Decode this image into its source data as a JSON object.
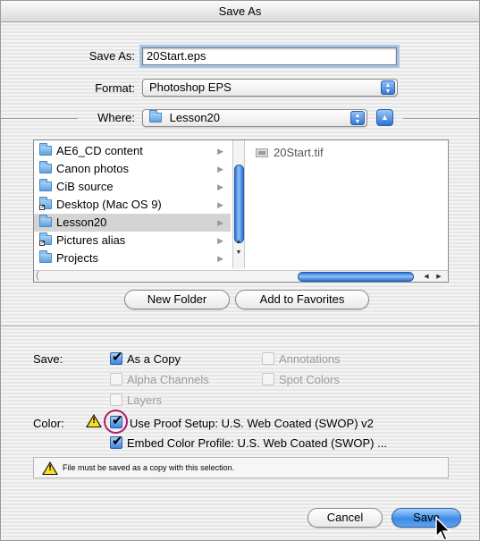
{
  "window": {
    "title": "Save As"
  },
  "form": {
    "save_as_label": "Save As:",
    "save_as_value": "20Start.eps",
    "format_label": "Format:",
    "format_value": "Photoshop EPS",
    "where_label": "Where:",
    "where_value": "Lesson20"
  },
  "browser": {
    "folders": [
      {
        "label": "AE6_CD content",
        "icon": "folder-icon",
        "selected": false
      },
      {
        "label": "Canon photos",
        "icon": "folder-icon",
        "selected": false
      },
      {
        "label": "CiB source",
        "icon": "folder-icon",
        "selected": false
      },
      {
        "label": "Desktop (Mac OS 9)",
        "icon": "alias-folder-icon",
        "selected": false
      },
      {
        "label": "Lesson20",
        "icon": "folder-icon",
        "selected": true
      },
      {
        "label": "Pictures alias",
        "icon": "alias-folder-icon",
        "selected": false
      },
      {
        "label": "Projects",
        "icon": "folder-icon",
        "selected": false
      }
    ],
    "files": [
      {
        "label": "20Start.tif",
        "icon": "image-file-icon"
      }
    ]
  },
  "buttons": {
    "new_folder": "New Folder",
    "add_favorites": "Add to Favorites",
    "cancel": "Cancel",
    "save": "Save"
  },
  "options": {
    "save_label": "Save:",
    "as_a_copy": "As a Copy",
    "alpha_channels": "Alpha Channels",
    "layers": "Layers",
    "annotations": "Annotations",
    "spot_colors": "Spot Colors",
    "color_label": "Color:",
    "use_proof_setup": "Use Proof Setup:  U.S. Web Coated (SWOP) v2",
    "embed_color_profile": "Embed Color Profile:  U.S. Web Coated (SWOP) ..."
  },
  "message": {
    "text": "File must be saved as a copy with this selection."
  },
  "colors": {
    "accent": "#3e8be6",
    "highlight_ring": "#b0186a",
    "warning": "#f7df1e"
  }
}
